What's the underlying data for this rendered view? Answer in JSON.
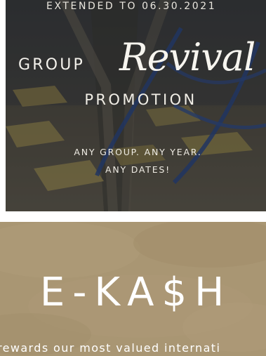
{
  "promo": {
    "extended": "EXTENDED TO 06.30.2021",
    "group": "GROUP",
    "revival": "Revival",
    "promotion": "PROMOTION",
    "tagline_line1": "ANY GROUP. ANY YEAR.",
    "tagline_line2": "ANY DATES!"
  },
  "ekash": {
    "title": "E-KA$H",
    "description": "rewards our most valued internati"
  },
  "colors": {
    "promo_overlay": "#3a3937",
    "ekash_background": "#a99673",
    "text_light": "#ffffff"
  }
}
